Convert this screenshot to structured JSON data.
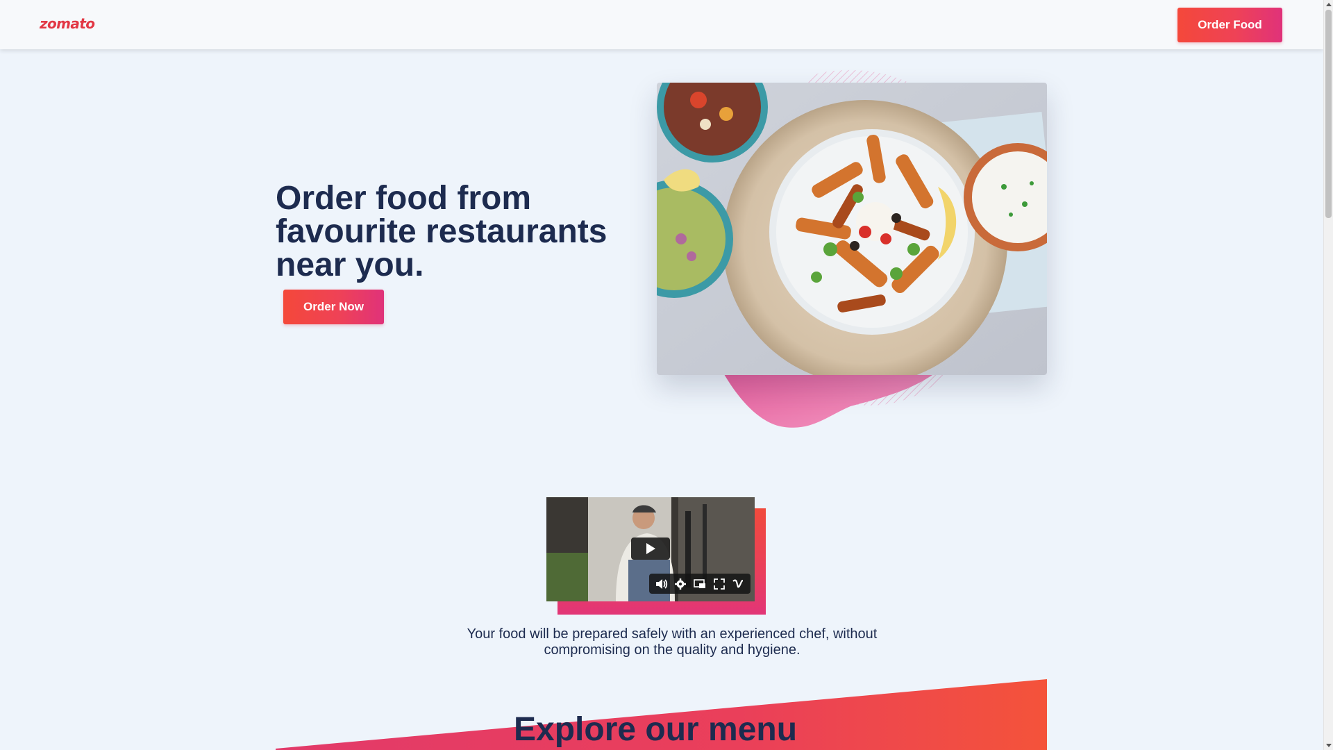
{
  "nav": {
    "logo": "zomato",
    "order_food_label": "Order Food"
  },
  "hero": {
    "title": "Order food from favourite restaurants near you.",
    "order_now_label": "Order Now"
  },
  "video": {
    "caption": "Your food will be prepared safely with an experienced chef, without compromising on the quality and hygiene.",
    "controls": [
      "volume-icon",
      "settings-icon",
      "picture-in-picture-icon",
      "fullscreen-icon",
      "vimeo-icon"
    ]
  },
  "menu": {
    "title": "Explore our menu"
  },
  "colors": {
    "brand": "#e23744",
    "accent_start": "#f4483a",
    "accent_end": "#e0327a",
    "heading": "#1d2b4f",
    "background": "#eef4fb"
  }
}
